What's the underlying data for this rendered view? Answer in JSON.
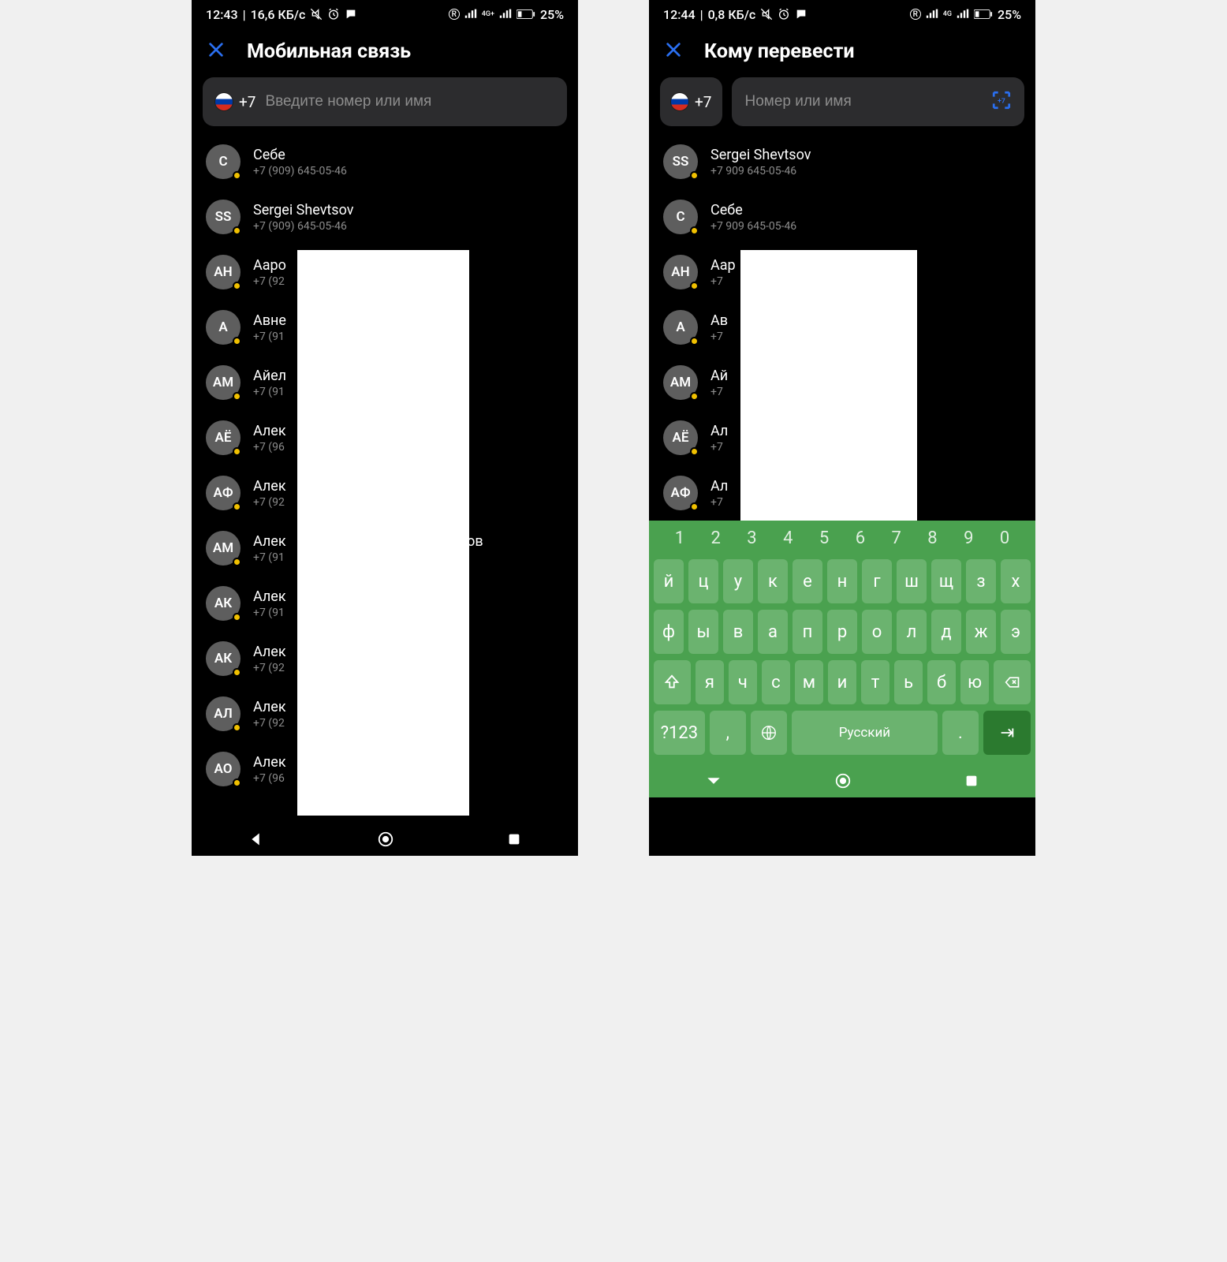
{
  "left": {
    "status": {
      "time": "12:43",
      "speed": "16,6 КБ/с",
      "battery": "25%",
      "net": "4G+"
    },
    "title": "Мобильная связь",
    "prefix": "+7",
    "placeholder": "Введите номер или имя",
    "contacts": [
      {
        "initials": "С",
        "name": "Себе",
        "sub": "+7 (909) 645-05-46"
      },
      {
        "initials": "SS",
        "name": "Sergei Shevtsov",
        "sub": "+7 (909) 645-05-46"
      },
      {
        "initials": "АН",
        "name": "Ааро",
        "sub": "+7 (92"
      },
      {
        "initials": "А",
        "name": "Авне",
        "sub": "+7 (91"
      },
      {
        "initials": "АМ",
        "name": "Айел",
        "sub": "+7 (91"
      },
      {
        "initials": "АЁ",
        "name": "Алек",
        "sub": "+7 (96"
      },
      {
        "initials": "АФ",
        "name": "Алек",
        "sub": "+7 (92"
      },
      {
        "initials": "АМ",
        "name": "Алек",
        "sub": "+7 (91",
        "suffix": "ков"
      },
      {
        "initials": "АК",
        "name": "Алек",
        "sub": "+7 (91"
      },
      {
        "initials": "АК",
        "name": "Алек",
        "sub": "+7 (92"
      },
      {
        "initials": "АЛ",
        "name": "Алек",
        "sub": "+7 (92"
      },
      {
        "initials": "АО",
        "name": "Алек",
        "sub": "+7 (96"
      }
    ]
  },
  "right": {
    "status": {
      "time": "12:44",
      "speed": "0,8 КБ/с",
      "battery": "25%",
      "net": "4G"
    },
    "title": "Кому перевести",
    "prefix": "+7",
    "placeholder": "Номер или имя",
    "contacts": [
      {
        "initials": "SS",
        "name": "Sergei Shevtsov",
        "sub": "+7 909 645-05-46"
      },
      {
        "initials": "С",
        "name": "Себе",
        "sub": "+7 909 645-05-46"
      },
      {
        "initials": "АН",
        "name": "Аар",
        "sub": "+7"
      },
      {
        "initials": "А",
        "name": "Ав",
        "sub": "+7"
      },
      {
        "initials": "АМ",
        "name": "Ай",
        "sub": "+7"
      },
      {
        "initials": "АЁ",
        "name": "Ал",
        "sub": "+7"
      },
      {
        "initials": "АФ",
        "name": "Ал",
        "sub": "+7"
      }
    ],
    "keyboard": {
      "nums": [
        "1",
        "2",
        "3",
        "4",
        "5",
        "6",
        "7",
        "8",
        "9",
        "0"
      ],
      "row1": [
        "й",
        "ц",
        "у",
        "к",
        "е",
        "н",
        "г",
        "ш",
        "щ",
        "з",
        "х"
      ],
      "row2": [
        "ф",
        "ы",
        "в",
        "а",
        "п",
        "р",
        "о",
        "л",
        "д",
        "ж",
        "э"
      ],
      "row3": [
        "я",
        "ч",
        "с",
        "м",
        "и",
        "т",
        "ь",
        "б",
        "ю"
      ],
      "sym": "?123",
      "comma": ",",
      "space": "Русский",
      "dot": "."
    }
  }
}
